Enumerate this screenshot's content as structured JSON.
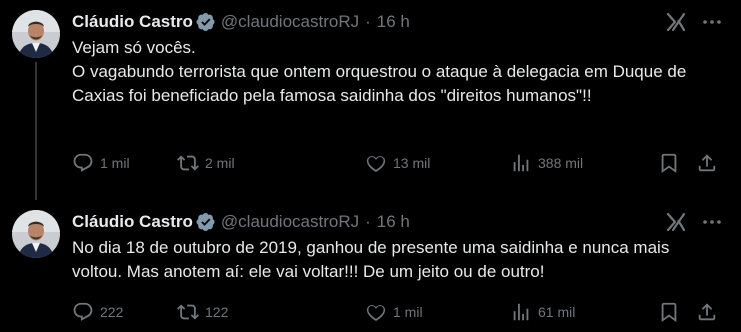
{
  "colors": {
    "background": "#000000",
    "primary_text": "#e7e9ea",
    "secondary_text": "#71767b",
    "verified_badge": "#829aab",
    "thread_line": "#333639"
  },
  "tweets": [
    {
      "author_name": "Cláudio Castro",
      "handle": "@claudiocastroRJ",
      "separator": "·",
      "time": "16 h",
      "avatar_icon": "profile-photo",
      "verified_icon": "verified-badge-icon",
      "grok_icon": "grok-icon",
      "more_icon": "more-options-icon",
      "text_lines": [
        "Vejam só vocês.",
        "O vagabundo terrorista que ontem orquestrou o ataque à delegacia em Duque de Caxias foi beneficiado pela famosa saidinha dos \"direitos humanos\"!!"
      ],
      "replies": "1 mil",
      "reposts": "2 mil",
      "likes": "13 mil",
      "views": "388 mil"
    },
    {
      "author_name": "Cláudio Castro",
      "handle": "@claudiocastroRJ",
      "separator": "·",
      "time": "16 h",
      "avatar_icon": "profile-photo",
      "verified_icon": "verified-badge-icon",
      "grok_icon": "grok-icon",
      "more_icon": "more-options-icon",
      "text_lines": [
        "No dia 18 de outubro de 2019, ganhou de presente uma saidinha e nunca mais voltou. Mas anotem aí: ele vai voltar!!! De um jeito ou de outro!"
      ],
      "replies": "222",
      "reposts": "122",
      "likes": "1 mil",
      "views": "61 mil"
    }
  ]
}
